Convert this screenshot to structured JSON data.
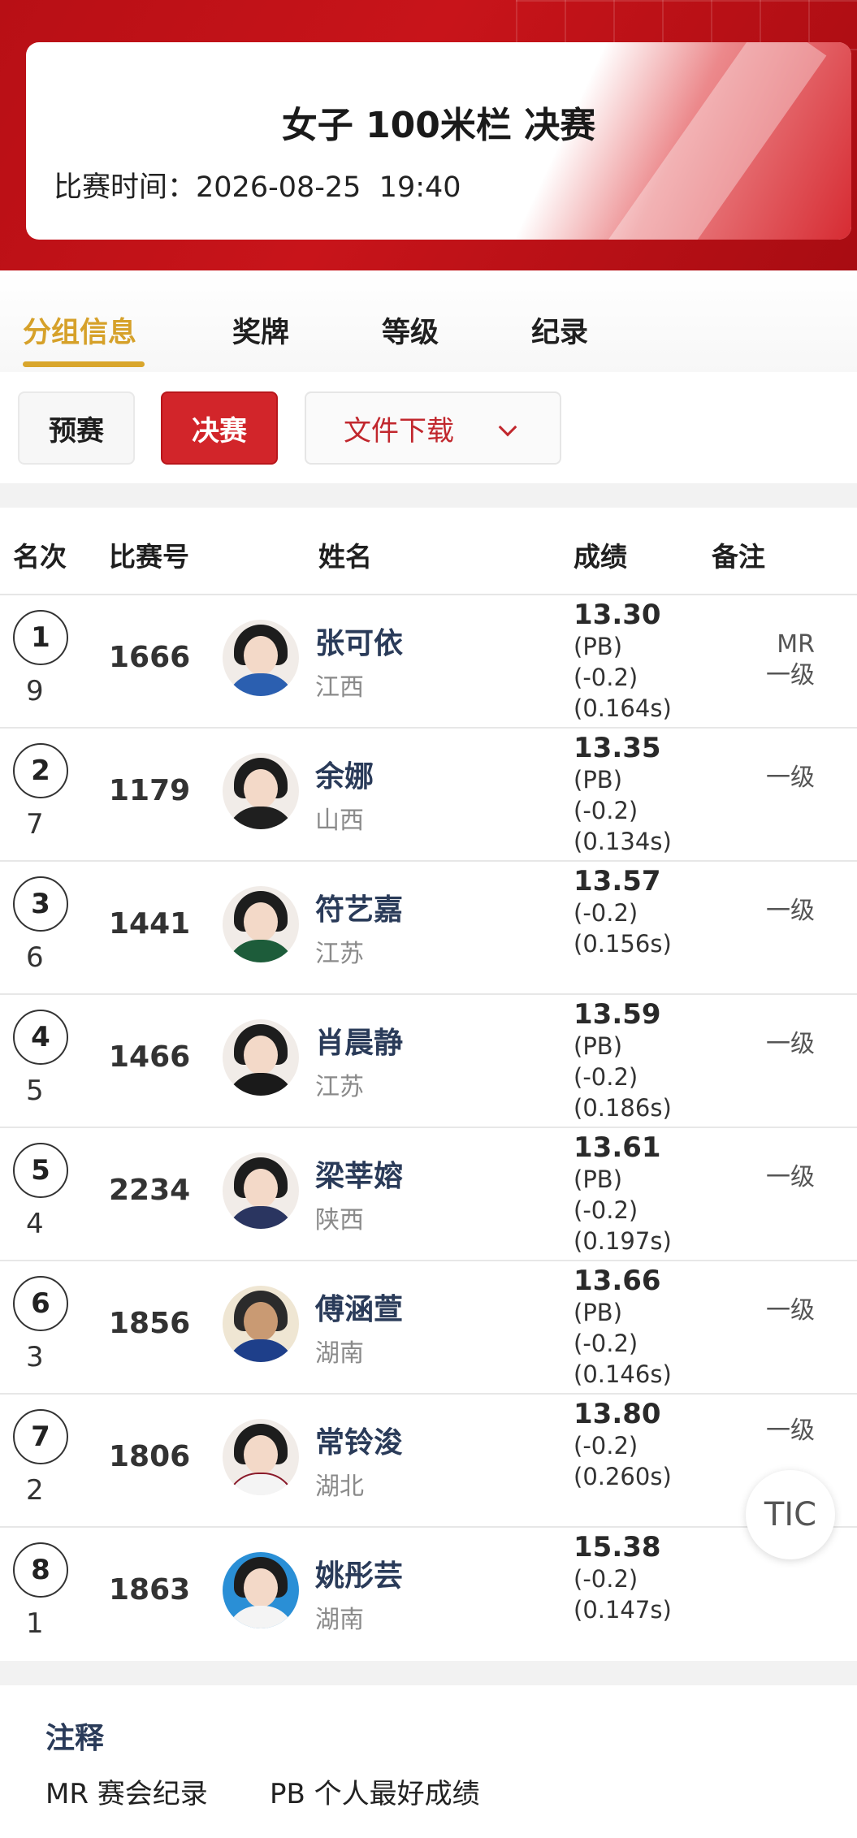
{
  "header": {
    "title": "女子 100米栏 决赛",
    "time_label": "比赛时间：",
    "time_value": "2026-08-25  19:40"
  },
  "tabs": [
    {
      "label": "分组信息",
      "active": true
    },
    {
      "label": "奖牌",
      "active": false
    },
    {
      "label": "等级",
      "active": false
    },
    {
      "label": "纪录",
      "active": false
    }
  ],
  "filters": {
    "prelim": "预赛",
    "final": "决赛",
    "download": "文件下载"
  },
  "table": {
    "headers": {
      "rank": "名次",
      "bib": "比赛号",
      "name": "姓名",
      "result": "成绩",
      "note": "备注"
    },
    "rows": [
      {
        "rank": "1",
        "lane": "9",
        "bib": "1666",
        "name": "张可依",
        "province": "江西",
        "mark": "13.30",
        "pb": "(PB)",
        "wind": "(-0.2)",
        "reaction": "(0.164s)",
        "note1": "MR",
        "note2": "一级"
      },
      {
        "rank": "2",
        "lane": "7",
        "bib": "1179",
        "name": "余娜",
        "province": "山西",
        "mark": "13.35",
        "pb": "(PB)",
        "wind": "(-0.2)",
        "reaction": "(0.134s)",
        "note1": "",
        "note2": "一级"
      },
      {
        "rank": "3",
        "lane": "6",
        "bib": "1441",
        "name": "符艺嘉",
        "province": "江苏",
        "mark": "13.57",
        "pb": "",
        "wind": "(-0.2)",
        "reaction": "(0.156s)",
        "note1": "",
        "note2": "一级"
      },
      {
        "rank": "4",
        "lane": "5",
        "bib": "1466",
        "name": "肖晨静",
        "province": "江苏",
        "mark": "13.59",
        "pb": "(PB)",
        "wind": "(-0.2)",
        "reaction": "(0.186s)",
        "note1": "",
        "note2": "一级"
      },
      {
        "rank": "5",
        "lane": "4",
        "bib": "2234",
        "name": "梁莘嫆",
        "province": "陕西",
        "mark": "13.61",
        "pb": "(PB)",
        "wind": "(-0.2)",
        "reaction": "(0.197s)",
        "note1": "",
        "note2": "一级"
      },
      {
        "rank": "6",
        "lane": "3",
        "bib": "1856",
        "name": "傅涵萱",
        "province": "湖南",
        "mark": "13.66",
        "pb": "(PB)",
        "wind": "(-0.2)",
        "reaction": "(0.146s)",
        "note1": "",
        "note2": "一级"
      },
      {
        "rank": "7",
        "lane": "2",
        "bib": "1806",
        "name": "常铃浚",
        "province": "湖北",
        "mark": "13.80",
        "pb": "",
        "wind": "(-0.2)",
        "reaction": "(0.260s)",
        "note1": "",
        "note2": "一级"
      },
      {
        "rank": "8",
        "lane": "1",
        "bib": "1863",
        "name": "姚彤芸",
        "province": "湖南",
        "mark": "15.38",
        "pb": "",
        "wind": "(-0.2)",
        "reaction": "(0.147s)",
        "note1": "",
        "note2": ""
      }
    ]
  },
  "fab": {
    "label": "TIC"
  },
  "footer": {
    "title": "注释",
    "legend": [
      "MR 赛会纪录",
      "PB 个人最好成绩"
    ]
  },
  "colors": {
    "brand_red": "#c8141a",
    "active_gold": "#d6a12a",
    "name_navy": "#2a3b59"
  },
  "icons": {
    "download_chevron": "chevron-down-icon"
  }
}
